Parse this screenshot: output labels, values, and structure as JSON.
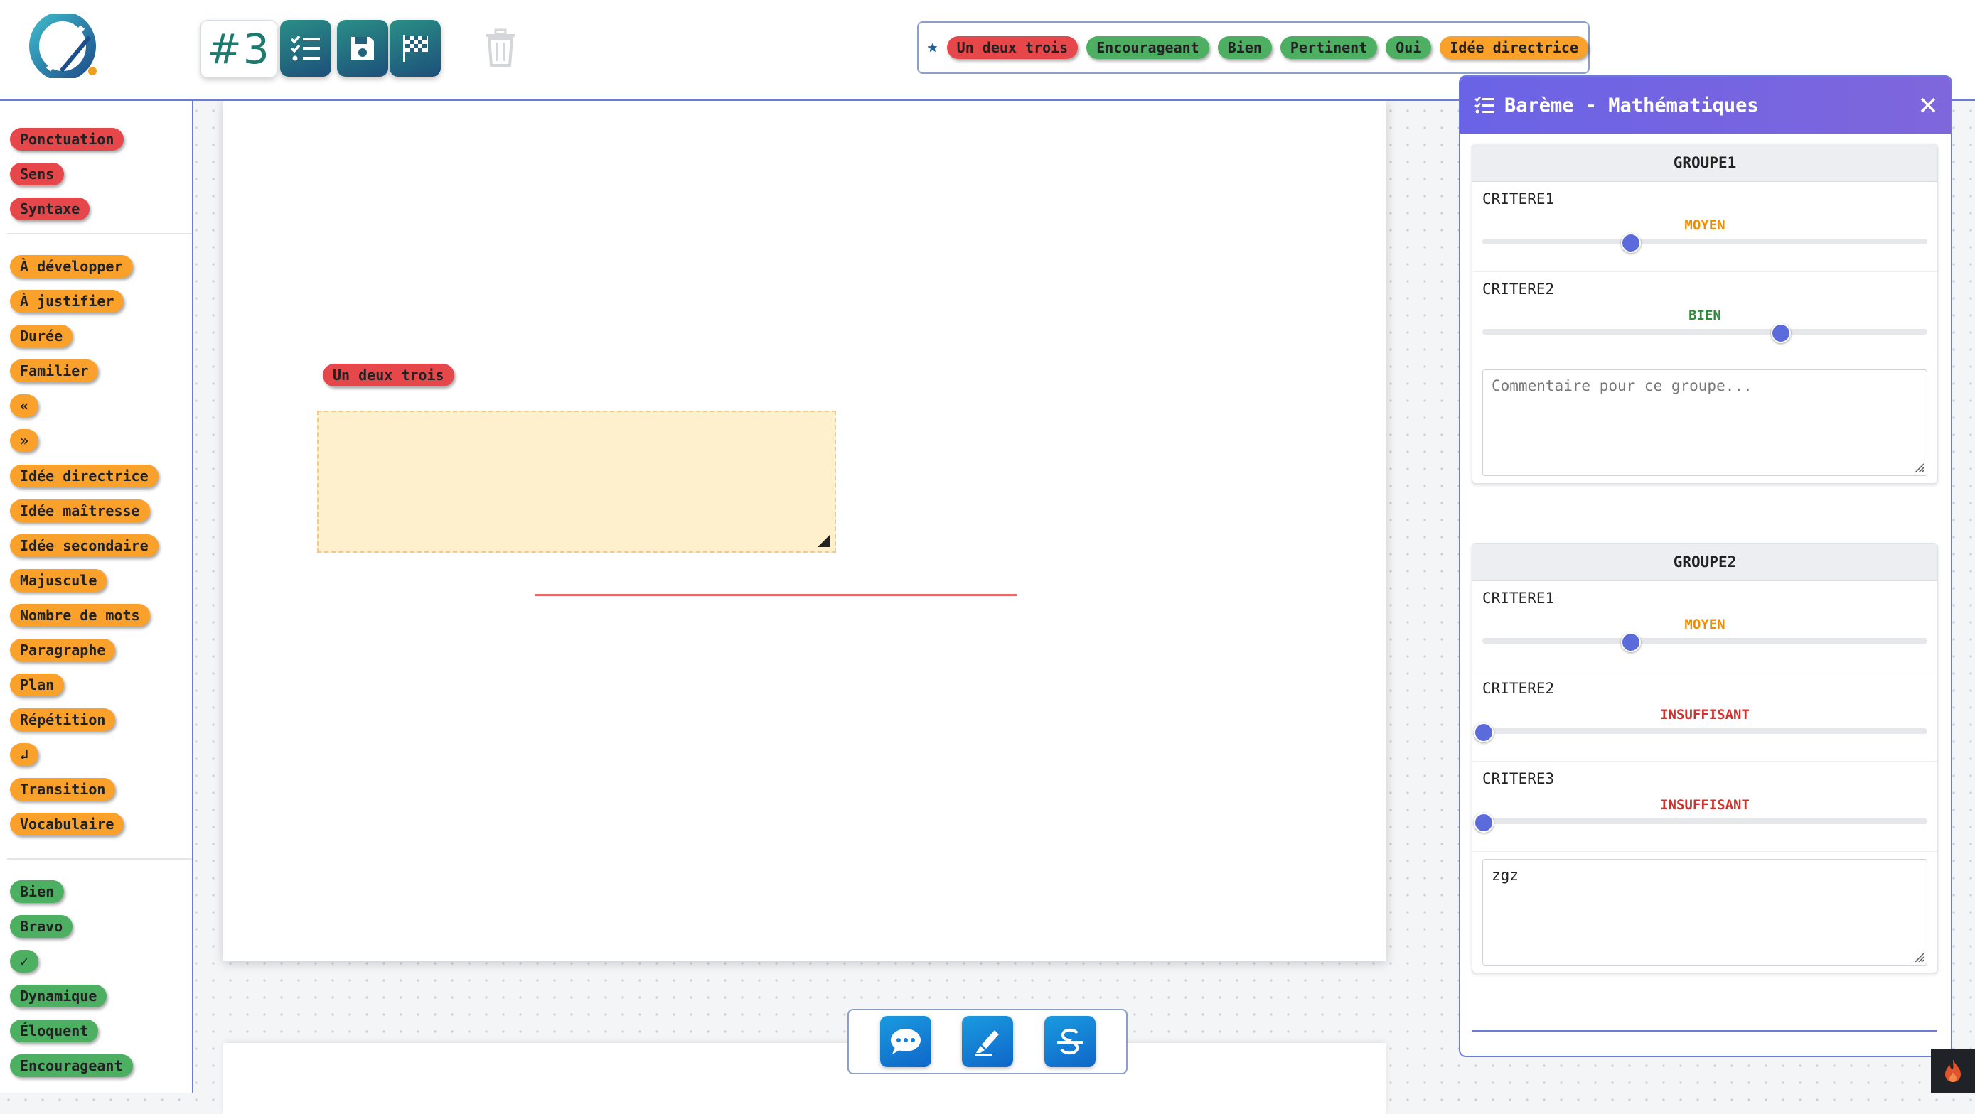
{
  "header": {
    "number_label": "#3",
    "buttons": {
      "rubric": "rubric-icon",
      "save": "save-icon",
      "finish": "flag-icon",
      "trash": "trash-icon"
    }
  },
  "favorites": [
    {
      "label": "Un deux trois",
      "color": "red"
    },
    {
      "label": "Encourageant",
      "color": "green"
    },
    {
      "label": "Bien",
      "color": "green"
    },
    {
      "label": "Pertinent",
      "color": "green"
    },
    {
      "label": "Oui",
      "color": "green"
    },
    {
      "label": "Idée directrice",
      "color": "orange"
    }
  ],
  "sidebar": {
    "red_tags": [
      "Ponctuation",
      "Sens",
      "Syntaxe"
    ],
    "orange_tags": [
      "À développer",
      "À justifier",
      "Durée",
      "Familier",
      "«",
      "»",
      "Idée directrice",
      "Idée maîtresse",
      "Idée secondaire",
      "Majuscule",
      "Nombre de mots",
      "Paragraphe",
      "Plan",
      "Répétition",
      "↲",
      "Transition",
      "Vocabulaire"
    ],
    "green_tags": [
      "Bien",
      "Bravo",
      "✓",
      "Dynamique",
      "Éloquent",
      "Encourageant"
    ]
  },
  "document": {
    "annotation_tag": "Un deux trois"
  },
  "panel": {
    "title": "Barème - Mathématiques",
    "groups": [
      {
        "name": "GROUPE1",
        "criteria": [
          {
            "label": "CRITERE1",
            "level": "MOYEN",
            "value": 0.33,
            "color": "#f08c00"
          },
          {
            "label": "CRITERE2",
            "level": "BIEN",
            "value": 0.667,
            "color": "#2e8b3a"
          }
        ],
        "comment_placeholder": "Commentaire pour ce groupe...",
        "comment_value": ""
      },
      {
        "name": "GROUPE2",
        "criteria": [
          {
            "label": "CRITERE1",
            "level": "MOYEN",
            "value": 0.33,
            "color": "#f08c00"
          },
          {
            "label": "CRITERE2",
            "level": "INSUFFISANT",
            "value": 0,
            "color": "#d0312d"
          },
          {
            "label": "CRITERE3",
            "level": "INSUFFISANT",
            "value": 0,
            "color": "#d0312d"
          }
        ],
        "comment_placeholder": "Commentaire pour ce groupe...",
        "comment_value": "zgz"
      }
    ]
  },
  "colors": {
    "accent": "#6b7bd8",
    "red": "#e5474a",
    "green": "#4caf62",
    "orange": "#f9a12a"
  }
}
